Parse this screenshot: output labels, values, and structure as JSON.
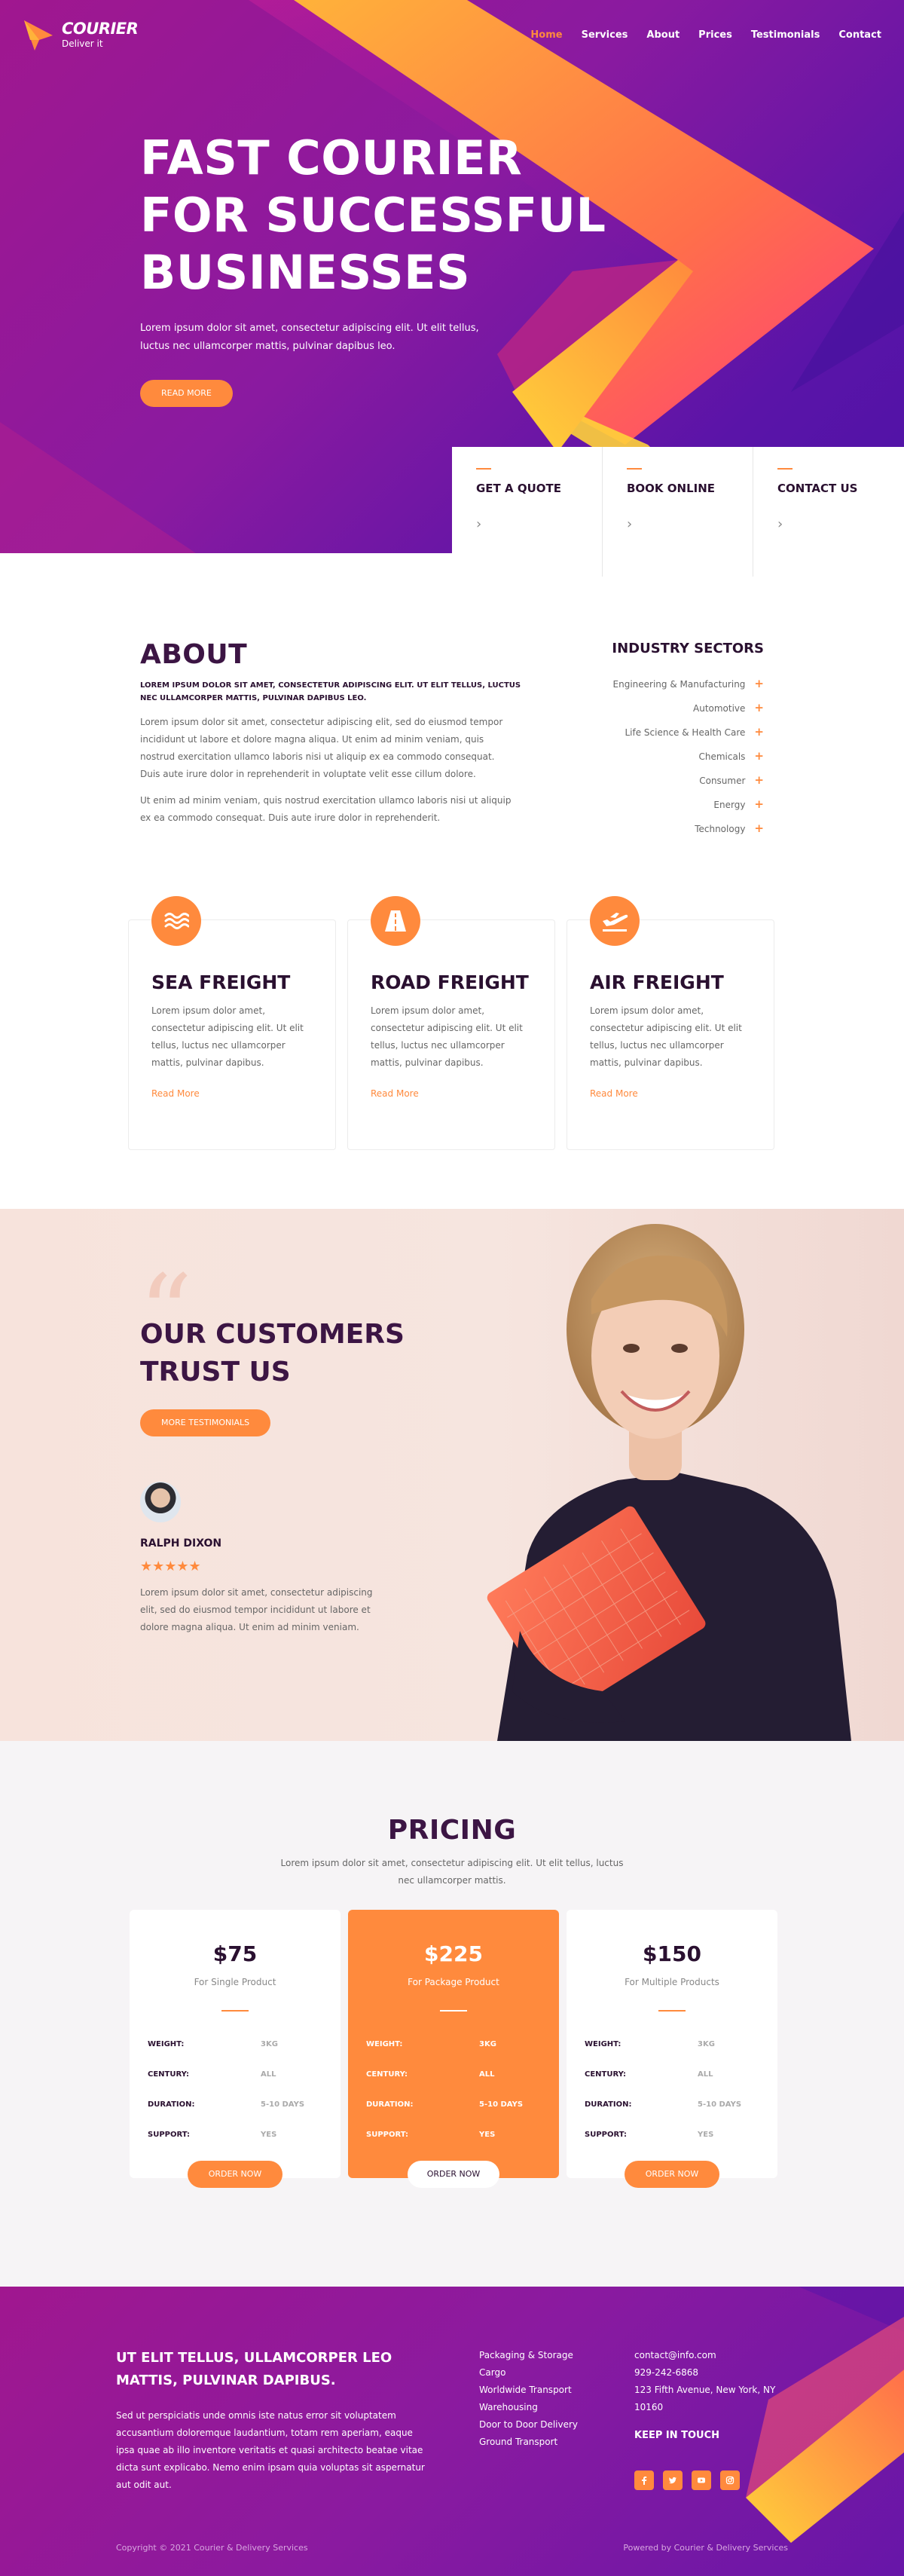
{
  "nav": {
    "brand_name": "COURIER",
    "brand_tagline": "Deliver it",
    "items": [
      {
        "label": "Home",
        "active": true
      },
      {
        "label": "Services"
      },
      {
        "label": "About"
      },
      {
        "label": "Prices"
      },
      {
        "label": "Testimonials"
      },
      {
        "label": "Contact"
      }
    ]
  },
  "hero": {
    "title_lines": [
      "FAST COURIER",
      "FOR SUCCESSFUL",
      "BUSINESSES"
    ],
    "description": "Lorem ipsum dolor sit amet, consectetur adipiscing elit. Ut elit tellus, luctus nec ullamcorper mattis, pulvinar dapibus leo.",
    "button_label": "READ MORE"
  },
  "quick_links": [
    {
      "label": "GET A QUOTE"
    },
    {
      "label": "BOOK ONLINE"
    },
    {
      "label": "CONTACT US"
    }
  ],
  "about": {
    "title": "ABOUT",
    "subtitle": "LOREM IPSUM DOLOR SIT AMET, CONSECTETUR ADIPISCING ELIT. UT ELIT TELLUS, LUCTUS NEC ULLAMCORPER MATTIS, PULVINAR DAPIBUS LEO.",
    "para1": "Lorem ipsum dolor sit amet, consectetur adipiscing elit, sed do eiusmod tempor incididunt ut labore et dolore magna aliqua. Ut enim ad minim veniam, quis nostrud exercitation ullamco laboris nisi ut aliquip ex ea commodo consequat. Duis aute irure dolor in reprehenderit in voluptate velit esse cillum dolore.",
    "para2": "Ut enim ad minim veniam, quis nostrud exercitation ullamco laboris nisi ut aliquip ex ea commodo consequat. Duis aute irure dolor in reprehenderit."
  },
  "sectors": {
    "title": "INDUSTRY SECTORS",
    "items": [
      "Engineering & Manufacturing",
      "Automotive",
      "Life Science & Health Care",
      "Chemicals",
      "Consumer",
      "Energy",
      "Technology"
    ]
  },
  "freight": [
    {
      "title": "SEA FREIGHT",
      "icon": "waves-icon",
      "text": "Lorem ipsum dolor amet, consectetur adipiscing elit. Ut elit tellus, luctus nec ullamcorper mattis, pulvinar dapibus.",
      "link": "Read More"
    },
    {
      "title": "ROAD FREIGHT",
      "icon": "road-icon",
      "text": "Lorem ipsum dolor amet, consectetur adipiscing elit. Ut elit tellus, luctus nec ullamcorper mattis, pulvinar dapibus.",
      "link": "Read More"
    },
    {
      "title": "AIR FREIGHT",
      "icon": "airplane-icon",
      "text": "Lorem ipsum dolor amet, consectetur adipiscing elit. Ut elit tellus, luctus nec ullamcorper mattis, pulvinar dapibus.",
      "link": "Read More"
    }
  ],
  "testimonials": {
    "title_lines": [
      "OUR CUSTOMERS",
      "TRUST US"
    ],
    "button_label": "MORE TESTIMONIALS",
    "name": "RALPH DIXON",
    "rating": 5,
    "stars": "★★★★★",
    "quote": "Lorem ipsum dolor sit amet, consectetur adipiscing elit, sed do eiusmod tempor incididunt ut labore et dolore magna aliqua. Ut enim ad minim veniam."
  },
  "pricing": {
    "title": "PRICING",
    "subtitle": "Lorem ipsum dolor sit amet, consectetur adipiscing elit. Ut elit tellus, luctus nec ullamcorper mattis.",
    "labels": {
      "weight": "WEIGHT:",
      "century": "CENTURY:",
      "duration": "DURATION:",
      "support": "SUPPORT:"
    },
    "plans": [
      {
        "price": "$75",
        "for": "For Single Product",
        "weight": "3KG",
        "century": "ALL",
        "duration": "5-10 DAYS",
        "support": "YES",
        "button": "ORDER NOW",
        "highlight": false
      },
      {
        "price": "$225",
        "for": "For Package Product",
        "weight": "3KG",
        "century": "ALL",
        "duration": "5-10 DAYS",
        "support": "YES",
        "button": "ORDER NOW",
        "highlight": true
      },
      {
        "price": "$150",
        "for": "For Multiple Products",
        "weight": "3KG",
        "century": "ALL",
        "duration": "5-10 DAYS",
        "support": "YES",
        "button": "ORDER NOW",
        "highlight": false
      }
    ]
  },
  "footer": {
    "heading": "UT ELIT TELLUS, ULLAMCORPER LEO MATTIS, PULVINAR DAPIBUS.",
    "description": "Sed ut perspiciatis unde omnis iste natus error sit voluptatem accusantium doloremque laudantium, totam rem aperiam, eaque ipsa quae ab illo inventore veritatis et quasi architecto beatae vitae dicta sunt explicabo. Nemo enim ipsam quia voluptas sit aspernatur aut odit aut.",
    "services": [
      "Packaging & Storage",
      "Cargo",
      "Worldwide Transport",
      "Warehousing",
      "Door to Door Delivery",
      "Ground Transport"
    ],
    "email": "contact@info.com",
    "phone": "929-242-6868",
    "address": "123 Fifth Avenue, New York, NY 10160",
    "keep_in_touch": "KEEP IN TOUCH",
    "social": [
      "facebook-icon",
      "twitter-icon",
      "youtube-icon",
      "instagram-icon"
    ],
    "copyright": "Copyright © 2021 Courier & Delivery Services",
    "powered": "Powered by Courier & Delivery Services"
  },
  "colors": {
    "accent": "#ff8a3d",
    "purple": "#8a1aa0",
    "dark": "#3c1544"
  }
}
